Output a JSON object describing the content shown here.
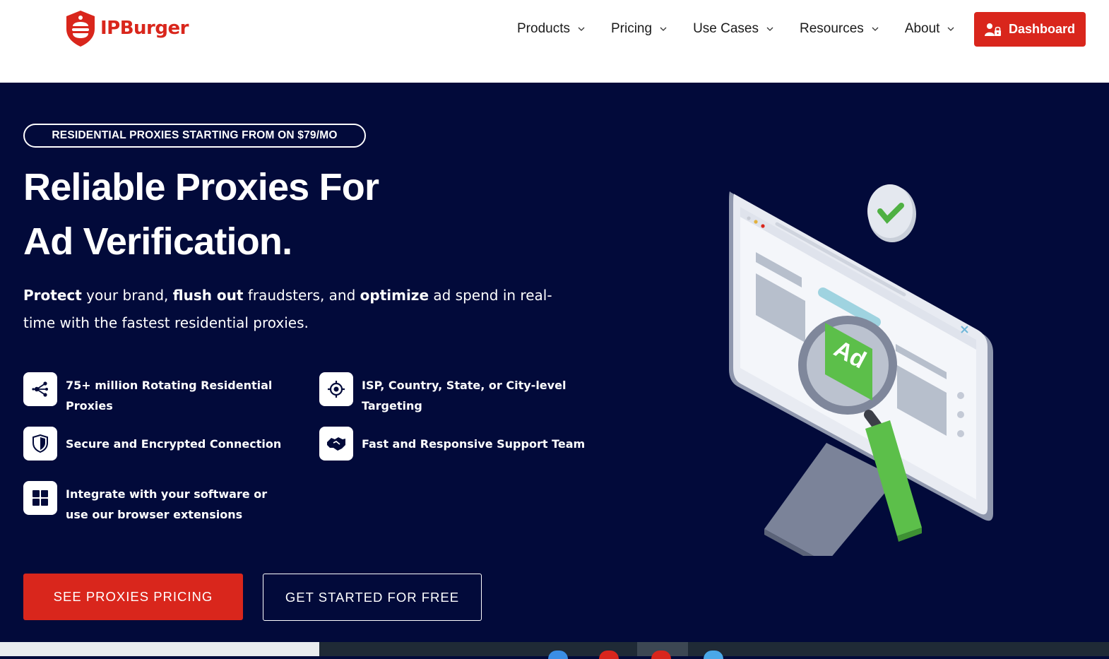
{
  "brand": {
    "logo_text": "IPBurger",
    "color": "#d9261c"
  },
  "nav": {
    "items": [
      {
        "label": "Products"
      },
      {
        "label": "Pricing"
      },
      {
        "label": "Use Cases"
      },
      {
        "label": "Resources"
      },
      {
        "label": "About"
      }
    ],
    "dashboard_label": "Dashboard"
  },
  "hero": {
    "badge": "RESIDENTIAL PROXIES STARTING FROM ON $79/MO",
    "title_line1": "Reliable Proxies For",
    "title_line2": "Ad Verification.",
    "subtitle": {
      "w1": "Protect",
      "t1": " your brand, ",
      "w2": "flush out",
      "t2": " fraudsters, and ",
      "w3": "optimize",
      "t3": " ad spend in real-time with the fastest residential proxies."
    },
    "features": [
      {
        "text": "75+ million Rotating Residential Proxies",
        "icon": "network-share-icon"
      },
      {
        "text": "ISP, Country, State, or City-level Targeting",
        "icon": "crosshair-target-icon"
      },
      {
        "text": "Secure and Encrypted Connection",
        "icon": "shield-icon"
      },
      {
        "text": "Fast and Responsive Support Team",
        "icon": "handshake-icon"
      },
      {
        "text": "Integrate with your software or use our browser extensions",
        "icon": "grid-apps-icon"
      }
    ],
    "cta_primary": "SEE PROXIES PRICING",
    "cta_secondary": "GET STARTED FOR FREE",
    "illustration_label": "Ad"
  },
  "colors": {
    "hero_bg": "#020a3a",
    "accent_red": "#d9261c",
    "accent_green": "#5cbf4a"
  }
}
